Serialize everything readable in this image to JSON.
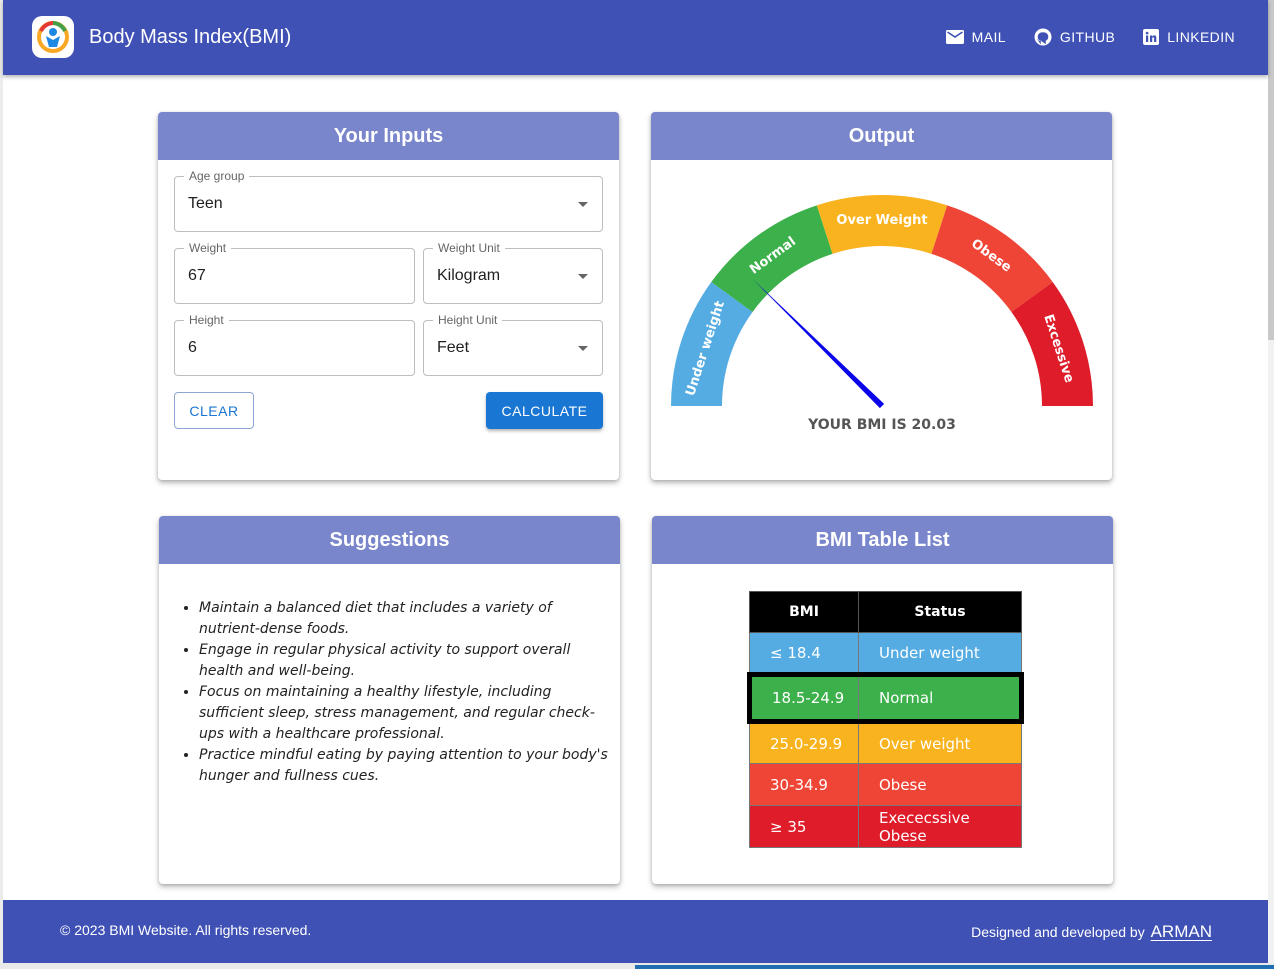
{
  "header": {
    "title": "Body Mass Index(BMI)",
    "nav": [
      {
        "label": "MAIL",
        "icon": "mail-icon"
      },
      {
        "label": "GITHUB",
        "icon": "github-icon"
      },
      {
        "label": "LINKEDIN",
        "icon": "linkedin-icon"
      }
    ]
  },
  "inputs": {
    "title": "Your Inputs",
    "age_group": {
      "label": "Age group",
      "value": "Teen"
    },
    "weight": {
      "label": "Weight",
      "value": "67"
    },
    "weight_unit": {
      "label": "Weight Unit",
      "value": "Kilogram"
    },
    "height": {
      "label": "Height",
      "value": "6"
    },
    "height_unit": {
      "label": "Height Unit",
      "value": "Feet"
    },
    "clear_label": "CLEAR",
    "calculate_label": "CALCULATE"
  },
  "output": {
    "title": "Output",
    "result_text": "YOUR BMI IS 20.03",
    "gauge": {
      "bmi_value": 20.03,
      "segments": [
        {
          "label": "Under weight",
          "color": "#55ace3"
        },
        {
          "label": "Normal",
          "color": "#3cb04a"
        },
        {
          "label": "Over Weight",
          "color": "#f9b31e"
        },
        {
          "label": "Obese",
          "color": "#ef4536"
        },
        {
          "label": "Excessive",
          "color": "#de1c2a"
        }
      ],
      "needle_color": "#0a06e8"
    }
  },
  "suggestions": {
    "title": "Suggestions",
    "items": [
      "Maintain a balanced diet that includes a variety of nutrient-dense foods.",
      "Engage in regular physical activity to support overall health and well-being.",
      "Focus on maintaining a healthy lifestyle, including sufficient sleep, stress management, and regular check-ups with a healthcare professional.",
      "Practice mindful eating by paying attention to your body's hunger and fullness cues."
    ]
  },
  "table": {
    "title": "BMI Table List",
    "headers": [
      "BMI",
      "Status"
    ],
    "rows": [
      {
        "bmi": "≤ 18.4",
        "status": "Under weight",
        "color": "#55ace3",
        "highlight": false
      },
      {
        "bmi": "18.5-24.9",
        "status": "Normal",
        "color": "#3cb04a",
        "highlight": true
      },
      {
        "bmi": "25.0-29.9",
        "status": "Over weight",
        "color": "#f9b31e",
        "highlight": false
      },
      {
        "bmi": "30-34.9",
        "status": "Obese",
        "color": "#ef4536",
        "highlight": false
      },
      {
        "bmi": "≥ 35",
        "status": "Exececssive Obese",
        "color": "#de1c2a",
        "highlight": false
      }
    ]
  },
  "footer": {
    "copyright": "© 2023 BMI Website. All rights reserved.",
    "credit": "Designed and developed by",
    "author": "ARMAN"
  },
  "colors": {
    "primary": "#3f51b5",
    "card_header": "#7986cb",
    "button": "#1976d2"
  }
}
